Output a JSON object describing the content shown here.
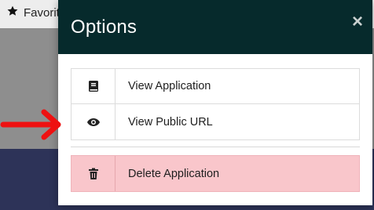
{
  "background": {
    "favorites_label": "Favorit"
  },
  "modal": {
    "title": "Options",
    "close_symbol": "×",
    "options": [
      {
        "label": "View Application",
        "icon": "book-icon"
      },
      {
        "label": "View Public URL",
        "icon": "eye-icon"
      }
    ],
    "danger_option": {
      "label": "Delete Application",
      "icon": "trash-icon"
    }
  },
  "colors": {
    "header_bg": "#062a2c",
    "danger_bg": "#f9c6cb",
    "arrow": "#ee1111",
    "overlay": "#8e8e8e",
    "footer_band": "#2d3358"
  }
}
